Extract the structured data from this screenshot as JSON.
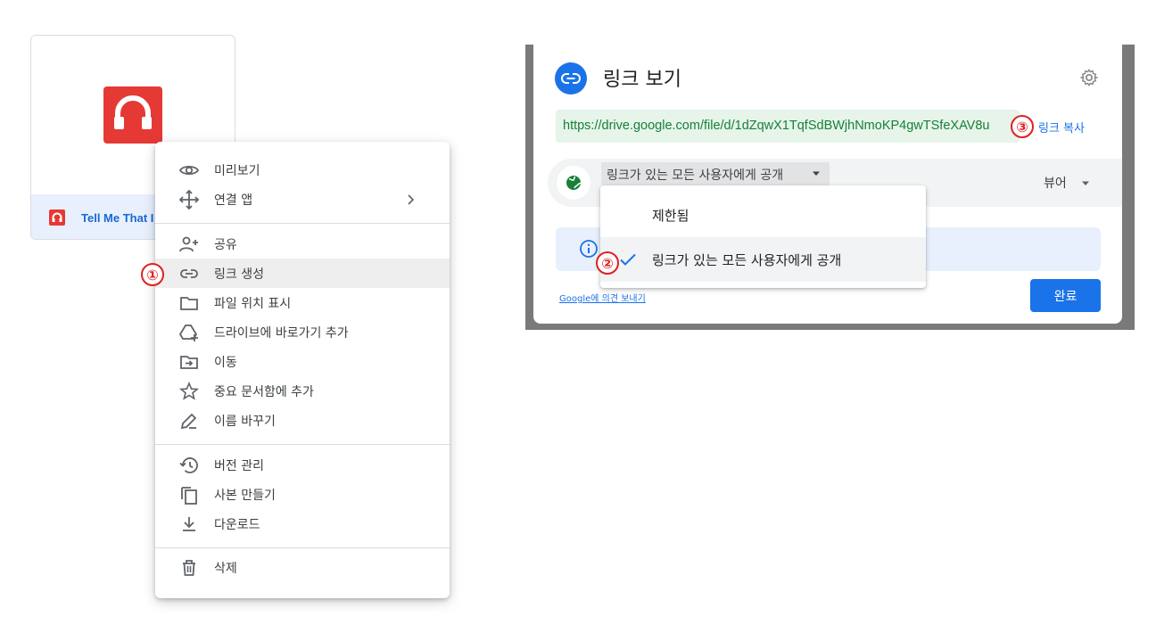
{
  "file": {
    "name": "Tell Me That I",
    "app_icon": "headphones-icon",
    "accent_color": "#e53935"
  },
  "context_menu": {
    "items": [
      {
        "label": "미리보기",
        "icon": "eye-icon"
      },
      {
        "label": "연결 앱",
        "icon": "move-arrows-icon"
      },
      {
        "label": "공유",
        "icon": "person-add-icon"
      },
      {
        "label": "링크 생성",
        "icon": "link-icon"
      },
      {
        "label": "파일 위치 표시",
        "icon": "folder-icon"
      },
      {
        "label": "드라이브에 바로가기 추가",
        "icon": "drive-add-icon"
      },
      {
        "label": "이동",
        "icon": "move-to-folder-icon"
      },
      {
        "label": "중요 문서함에 추가",
        "icon": "star-icon"
      },
      {
        "label": "이름 바꾸기",
        "icon": "pencil-icon"
      },
      {
        "label": "버전 관리",
        "icon": "history-icon"
      },
      {
        "label": "사본 만들기",
        "icon": "copy-icon"
      },
      {
        "label": "다운로드",
        "icon": "download-icon"
      },
      {
        "label": "삭제",
        "icon": "trash-icon"
      }
    ]
  },
  "steps": {
    "one": "①",
    "two": "②",
    "three": "③"
  },
  "dialog": {
    "title": "링크 보기",
    "url": "https://drive.google.com/file/d/1dZqwX1TqfSdBWjhNmoKP4gwTSfeXAV8u",
    "copy_link": "링크 복사",
    "access_value": "링크가 있는 모든 사용자에게 공개",
    "role": "뷰어",
    "feedback": "Google에 의견 보내기",
    "done": "완료",
    "primary_color": "#1a73e8"
  },
  "access_dropdown": {
    "options": [
      {
        "label": "제한됨",
        "selected": false
      },
      {
        "label": "링크가 있는 모든 사용자에게 공개",
        "selected": true
      }
    ]
  }
}
